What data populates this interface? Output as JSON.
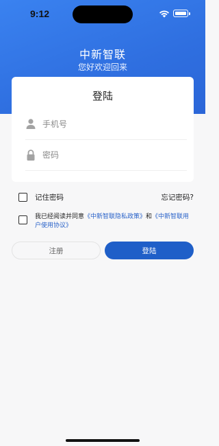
{
  "status_bar": {
    "time": "9:12",
    "icons": [
      "wifi-icon",
      "battery-icon"
    ]
  },
  "header": {
    "title": "中新智联",
    "subtitle": "您好欢迎回来",
    "background_color": "#2f6fe0"
  },
  "login_card": {
    "title": "登陆",
    "phone_field": {
      "placeholder": "手机号",
      "value": "",
      "icon": "user-icon"
    },
    "password_field": {
      "placeholder": "密码",
      "value": "",
      "icon": "lock-icon"
    }
  },
  "options": {
    "remember_label": "记住密码",
    "remember_checked": false,
    "forgot_label": "忘记密码?"
  },
  "agreement": {
    "checked": false,
    "prefix": "我已经阅读并同意",
    "privacy_link": "《中新智联隐私政策》",
    "conjunction": "和",
    "terms_link": "《中新智联用户使用协议》",
    "link_color": "#2a63c9"
  },
  "buttons": {
    "register_label": "注册",
    "login_label": "登陆",
    "login_color": "#1f5fc8"
  }
}
